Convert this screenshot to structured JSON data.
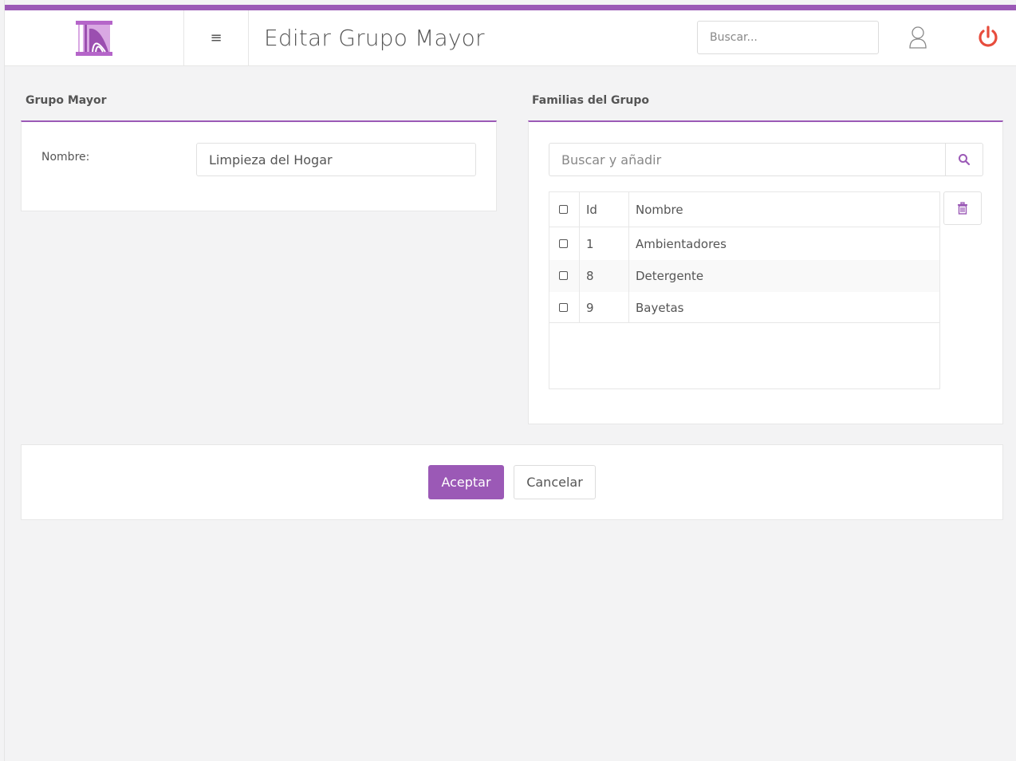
{
  "header": {
    "title": "Editar Grupo Mayor",
    "search_placeholder": "Buscar...",
    "menu_glyph": "≡",
    "icons": {
      "logo": "columns-logo-icon",
      "menu": "hamburger-menu-icon",
      "user": "user-icon",
      "power": "power-icon"
    },
    "accent_color": "#9b59b6",
    "power_color": "#e74c3c"
  },
  "grupo_mayor": {
    "heading": "Grupo Mayor",
    "nombre_label": "Nombre:",
    "nombre_value": "Limpieza del Hogar"
  },
  "familias": {
    "heading": "Familias del Grupo",
    "add_placeholder": "Buscar y añadir",
    "columns": {
      "id": "Id",
      "nombre": "Nombre"
    },
    "rows": [
      {
        "id": "1",
        "nombre": "Ambientadores"
      },
      {
        "id": "8",
        "nombre": "Detergente"
      },
      {
        "id": "9",
        "nombre": "Bayetas"
      }
    ]
  },
  "actions": {
    "accept": "Aceptar",
    "cancel": "Cancelar"
  }
}
